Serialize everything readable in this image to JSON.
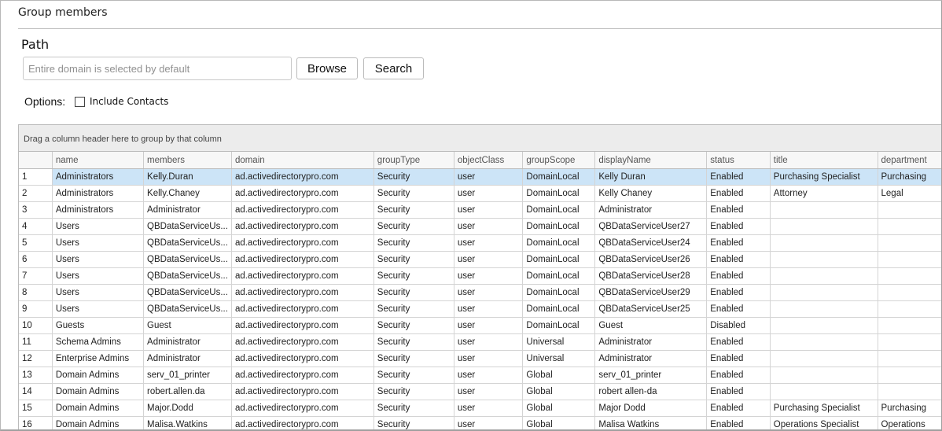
{
  "title": "Group members",
  "path_label": "Path",
  "path_placeholder": "Entire domain is selected by default",
  "browse": "Browse",
  "search": "Search",
  "options_label": "Options:",
  "include_contacts": "Include Contacts",
  "include_contacts_checked": false,
  "group_hint": "Drag a column header here to group by that column",
  "columns": [
    "",
    "name",
    "members",
    "domain",
    "groupType",
    "objectClass",
    "groupScope",
    "displayName",
    "status",
    "title",
    "department"
  ],
  "rows": [
    [
      "1",
      "Administrators",
      "Kelly.Duran",
      "ad.activedirectorypro.com",
      "Security",
      "user",
      "DomainLocal",
      "Kelly Duran",
      "Enabled",
      "Purchasing Specialist",
      "Purchasing"
    ],
    [
      "2",
      "Administrators",
      "Kelly.Chaney",
      "ad.activedirectorypro.com",
      "Security",
      "user",
      "DomainLocal",
      "Kelly Chaney",
      "Enabled",
      "Attorney",
      "Legal"
    ],
    [
      "3",
      "Administrators",
      "Administrator",
      "ad.activedirectorypro.com",
      "Security",
      "user",
      "DomainLocal",
      "Administrator",
      "Enabled",
      "",
      ""
    ],
    [
      "4",
      "Users",
      "QBDataServiceUs...",
      "ad.activedirectorypro.com",
      "Security",
      "user",
      "DomainLocal",
      "QBDataServiceUser27",
      "Enabled",
      "",
      ""
    ],
    [
      "5",
      "Users",
      "QBDataServiceUs...",
      "ad.activedirectorypro.com",
      "Security",
      "user",
      "DomainLocal",
      "QBDataServiceUser24",
      "Enabled",
      "",
      ""
    ],
    [
      "6",
      "Users",
      "QBDataServiceUs...",
      "ad.activedirectorypro.com",
      "Security",
      "user",
      "DomainLocal",
      "QBDataServiceUser26",
      "Enabled",
      "",
      ""
    ],
    [
      "7",
      "Users",
      "QBDataServiceUs...",
      "ad.activedirectorypro.com",
      "Security",
      "user",
      "DomainLocal",
      "QBDataServiceUser28",
      "Enabled",
      "",
      ""
    ],
    [
      "8",
      "Users",
      "QBDataServiceUs...",
      "ad.activedirectorypro.com",
      "Security",
      "user",
      "DomainLocal",
      "QBDataServiceUser29",
      "Enabled",
      "",
      ""
    ],
    [
      "9",
      "Users",
      "QBDataServiceUs...",
      "ad.activedirectorypro.com",
      "Security",
      "user",
      "DomainLocal",
      "QBDataServiceUser25",
      "Enabled",
      "",
      ""
    ],
    [
      "10",
      "Guests",
      "Guest",
      "ad.activedirectorypro.com",
      "Security",
      "user",
      "DomainLocal",
      "Guest",
      "Disabled",
      "",
      ""
    ],
    [
      "11",
      "Schema Admins",
      "Administrator",
      "ad.activedirectorypro.com",
      "Security",
      "user",
      "Universal",
      "Administrator",
      "Enabled",
      "",
      ""
    ],
    [
      "12",
      "Enterprise Admins",
      "Administrator",
      "ad.activedirectorypro.com",
      "Security",
      "user",
      "Universal",
      "Administrator",
      "Enabled",
      "",
      ""
    ],
    [
      "13",
      "Domain Admins",
      "serv_01_printer",
      "ad.activedirectorypro.com",
      "Security",
      "user",
      "Global",
      "serv_01_printer",
      "Enabled",
      "",
      ""
    ],
    [
      "14",
      "Domain Admins",
      "robert.allen.da",
      "ad.activedirectorypro.com",
      "Security",
      "user",
      "Global",
      "robert allen-da",
      "Enabled",
      "",
      ""
    ],
    [
      "15",
      "Domain Admins",
      "Major.Dodd",
      "ad.activedirectorypro.com",
      "Security",
      "user",
      "Global",
      "Major Dodd",
      "Enabled",
      "Purchasing Specialist",
      "Purchasing"
    ],
    [
      "16",
      "Domain Admins",
      "Malisa.Watkins",
      "ad.activedirectorypro.com",
      "Security",
      "user",
      "Global",
      "Malisa Watkins",
      "Enabled",
      "Operations Specialist",
      "Operations"
    ]
  ],
  "selected_row": 1
}
